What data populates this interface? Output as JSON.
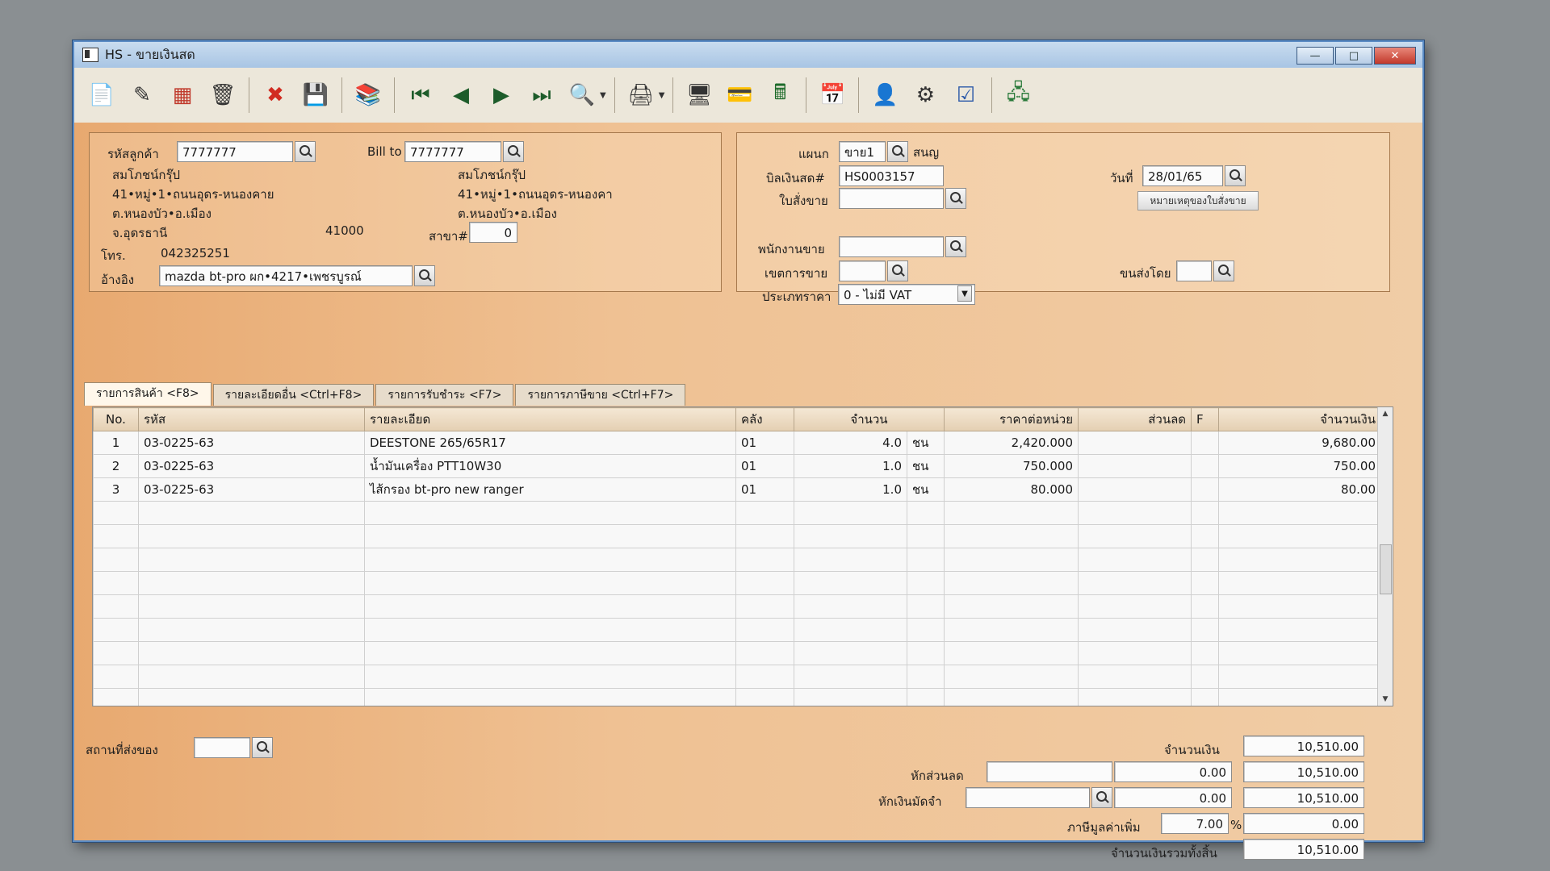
{
  "window": {
    "title": "HS - ขายเงินสด"
  },
  "customer": {
    "code_label": "รหัสลูกค้า",
    "code": "7777777",
    "name": "สมโภชน์กรุ๊ป",
    "addr1": "41•หมู่•1•ถนนอุดร-หนองคาย",
    "addr2": "ต.หนองบัว•อ.เมือง",
    "addr3": "จ.อุดรธานี",
    "zip": "41000",
    "phone_label": "โทร.",
    "phone": "042325251",
    "ref_label": "อ้างอิง",
    "ref": "mazda bt-pro ผก•4217•เพชรบูรณ์"
  },
  "bill_to": {
    "label": "Bill to",
    "code": "7777777",
    "name": "สมโภชน์กรุ๊ป",
    "addr1": "41•หมู่•1•ถนนอุดร-หนองคา",
    "addr2": "ต.หนองบัว•อ.เมือง",
    "branch_label": "สาขา#",
    "branch": "0"
  },
  "doc": {
    "dept_label": "แผนก",
    "dept": "ขาย1",
    "dept_name": "สนญ",
    "bill_label": "บิลเงินสด#",
    "bill": "HS0003157",
    "date_label": "วันที่",
    "date": "28/01/65",
    "so_label": "ใบสั่งขาย",
    "so": "",
    "so_note_button": "หมายเหตุของใบสั่งขาย",
    "salesman_label": "พนักงานขาย",
    "salesman": "",
    "zone_label": "เขตการขาย",
    "zone": "",
    "ship_by_label": "ขนส่งโดย",
    "ship_by": "",
    "price_type_label": "ประเภทราคา",
    "price_type": "0 - ไม่มี VAT"
  },
  "tabs": [
    {
      "label": "รายการสินค้า <F8>"
    },
    {
      "label": "รายละเอียดอื่น <Ctrl+F8>"
    },
    {
      "label": "รายการรับชำระ <F7>"
    },
    {
      "label": "รายการภาษีขาย <Ctrl+F7>"
    }
  ],
  "grid": {
    "headers": {
      "no": "No.",
      "code": "รหัส",
      "desc": "รายละเอียด",
      "wh": "คลัง",
      "qty": "จำนวน",
      "price": "ราคาต่อหน่วย",
      "disc": "ส่วนลด",
      "f": "F",
      "amount": "จำนวนเงิน"
    },
    "rows": [
      {
        "no": "1",
        "code": "03-0225-63",
        "desc": "DEESTONE 265/65R17",
        "wh": "01",
        "qty": "4.0",
        "unit": "ชน",
        "price": "2,420.000",
        "disc": "",
        "f": "",
        "amount": "9,680.00"
      },
      {
        "no": "2",
        "code": "03-0225-63",
        "desc": "น้ำมันเครื่อง PTT10W30",
        "wh": "01",
        "qty": "1.0",
        "unit": "ชน",
        "price": "750.000",
        "disc": "",
        "f": "",
        "amount": "750.00"
      },
      {
        "no": "3",
        "code": "03-0225-63",
        "desc": "ไส้กรอง bt-pro new ranger",
        "wh": "01",
        "qty": "1.0",
        "unit": "ชน",
        "price": "80.000",
        "disc": "",
        "f": "",
        "amount": "80.00"
      }
    ]
  },
  "footer": {
    "ship_place_label": "สถานที่ส่งของ",
    "ship_place": "",
    "amount_label": "จำนวนเงิน",
    "amount": "10,510.00",
    "discount_label": "หักส่วนลด",
    "discount_text": "",
    "discount": "0.00",
    "after_discount": "10,510.00",
    "deposit_label": "หักเงินมัดจำ",
    "deposit_text": "",
    "deposit": "0.00",
    "after_deposit": "10,510.00",
    "vat_label": "ภาษีมูลค่าเพิ่ม",
    "vat_rate": "7.00",
    "vat_pct": "%",
    "vat": "0.00",
    "total_label": "จำนวนเงินรวมทั้งสิ้น",
    "total": "10,510.00"
  }
}
